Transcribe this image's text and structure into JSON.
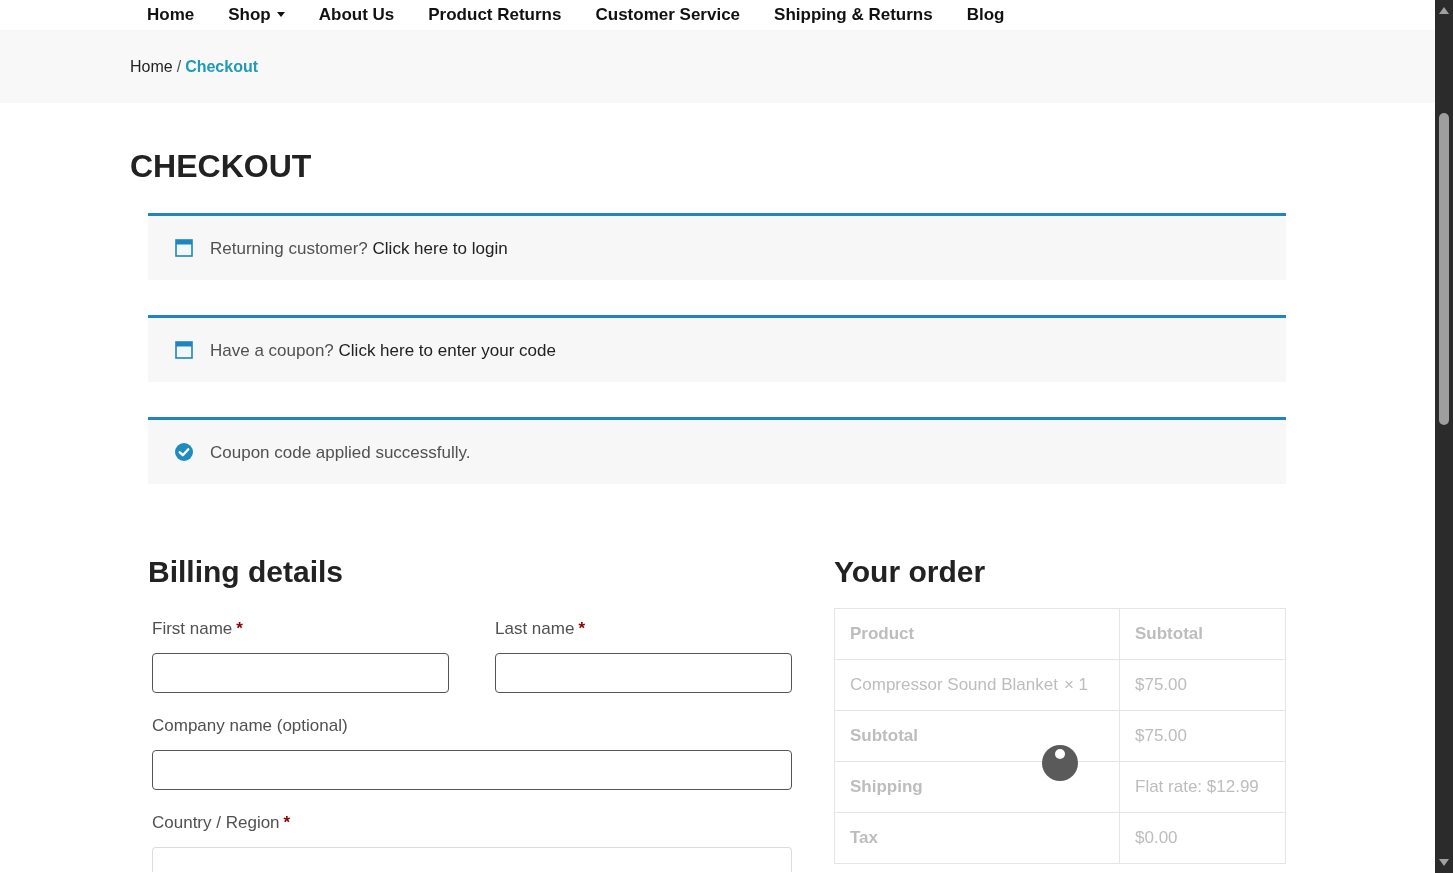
{
  "nav": {
    "items": [
      {
        "label": "Home",
        "dropdown": false
      },
      {
        "label": "Shop",
        "dropdown": true
      },
      {
        "label": "About Us",
        "dropdown": false
      },
      {
        "label": "Product Returns",
        "dropdown": false
      },
      {
        "label": "Customer Service",
        "dropdown": false
      },
      {
        "label": "Shipping & Returns",
        "dropdown": false
      },
      {
        "label": "Blog",
        "dropdown": false
      }
    ]
  },
  "breadcrumb": {
    "separator": "/",
    "items": [
      {
        "label": "Home",
        "current": false
      },
      {
        "label": "Checkout",
        "current": true
      }
    ]
  },
  "page_title": "CHECKOUT",
  "notices": [
    {
      "kind": "info",
      "text": "Returning customer?",
      "link": "Click here to login"
    },
    {
      "kind": "info",
      "text": "Have a coupon?",
      "link": "Click here to enter your code"
    },
    {
      "kind": "success",
      "text": "Coupon code applied successfully."
    }
  ],
  "billing": {
    "title": "Billing details",
    "fields": [
      {
        "kind": "half",
        "label": "First name",
        "required_mark": "*"
      },
      {
        "kind": "half",
        "label": "Last name",
        "required_mark": "*"
      },
      {
        "kind": "full",
        "label": "Company name (optional)"
      },
      {
        "kind": "select",
        "label": "Country / Region",
        "required_mark": "*"
      }
    ]
  },
  "order": {
    "title": "Your order",
    "blocked": true,
    "columns": [
      "Product",
      "Subtotal"
    ],
    "items": [
      {
        "product": "Compressor Sound Blanket",
        "quantity": "× 1",
        "subtotal": "$75.00"
      }
    ],
    "totals": [
      {
        "label": "Subtotal",
        "value": "$75.00"
      },
      {
        "label": "Shipping",
        "value": "Flat rate: $12.99"
      },
      {
        "label": "Tax",
        "value": "$0.00"
      }
    ]
  }
}
